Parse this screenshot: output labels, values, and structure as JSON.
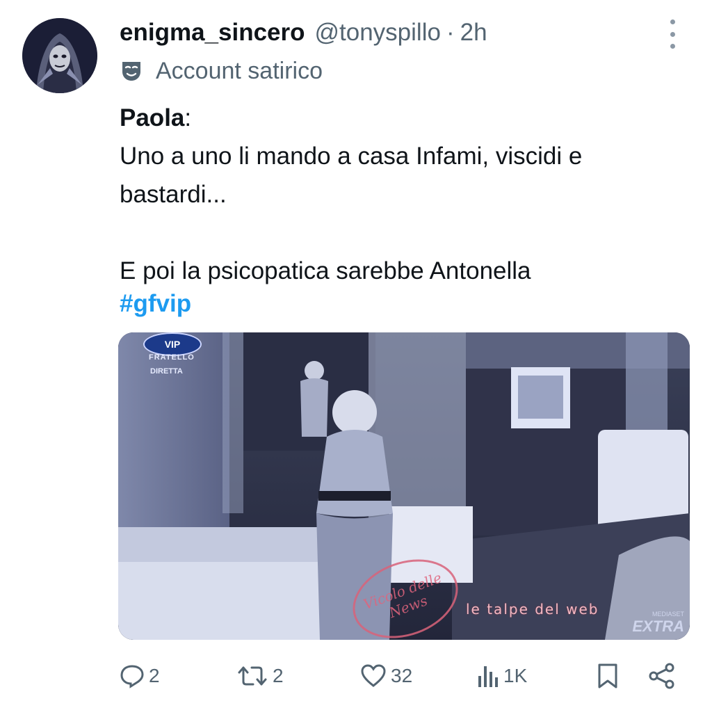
{
  "tweet": {
    "display_name": "enigma_sincero",
    "handle": "@tonyspillo",
    "separator": "·",
    "time": "2h",
    "label": "Account satirico",
    "label_icon": "theater-mask-icon",
    "body": {
      "speaker": "Paola",
      "speaker_suffix": ":",
      "line1": "Uno a uno li mando a casa Infami, viscidi e bastardi...",
      "line2": "E poi la psicopatica sarebbe Antonella",
      "hashtag": "#gfvip"
    },
    "media": {
      "overlay_logo_text": "VIP",
      "overlay_show_text": "FRATELLO",
      "overlay_live_text": "DIRETTA",
      "watermark_text": "le talpe del web",
      "channel_text": "EXTRA",
      "channel_small_text": "MEDIASET",
      "stamp_text": "Vicolo delle News"
    },
    "actions": {
      "replies": "2",
      "reposts": "2",
      "likes": "32",
      "views": "1K"
    }
  },
  "colors": {
    "link": "#1d9bf0",
    "secondary": "#536471",
    "text": "#0f1419"
  }
}
